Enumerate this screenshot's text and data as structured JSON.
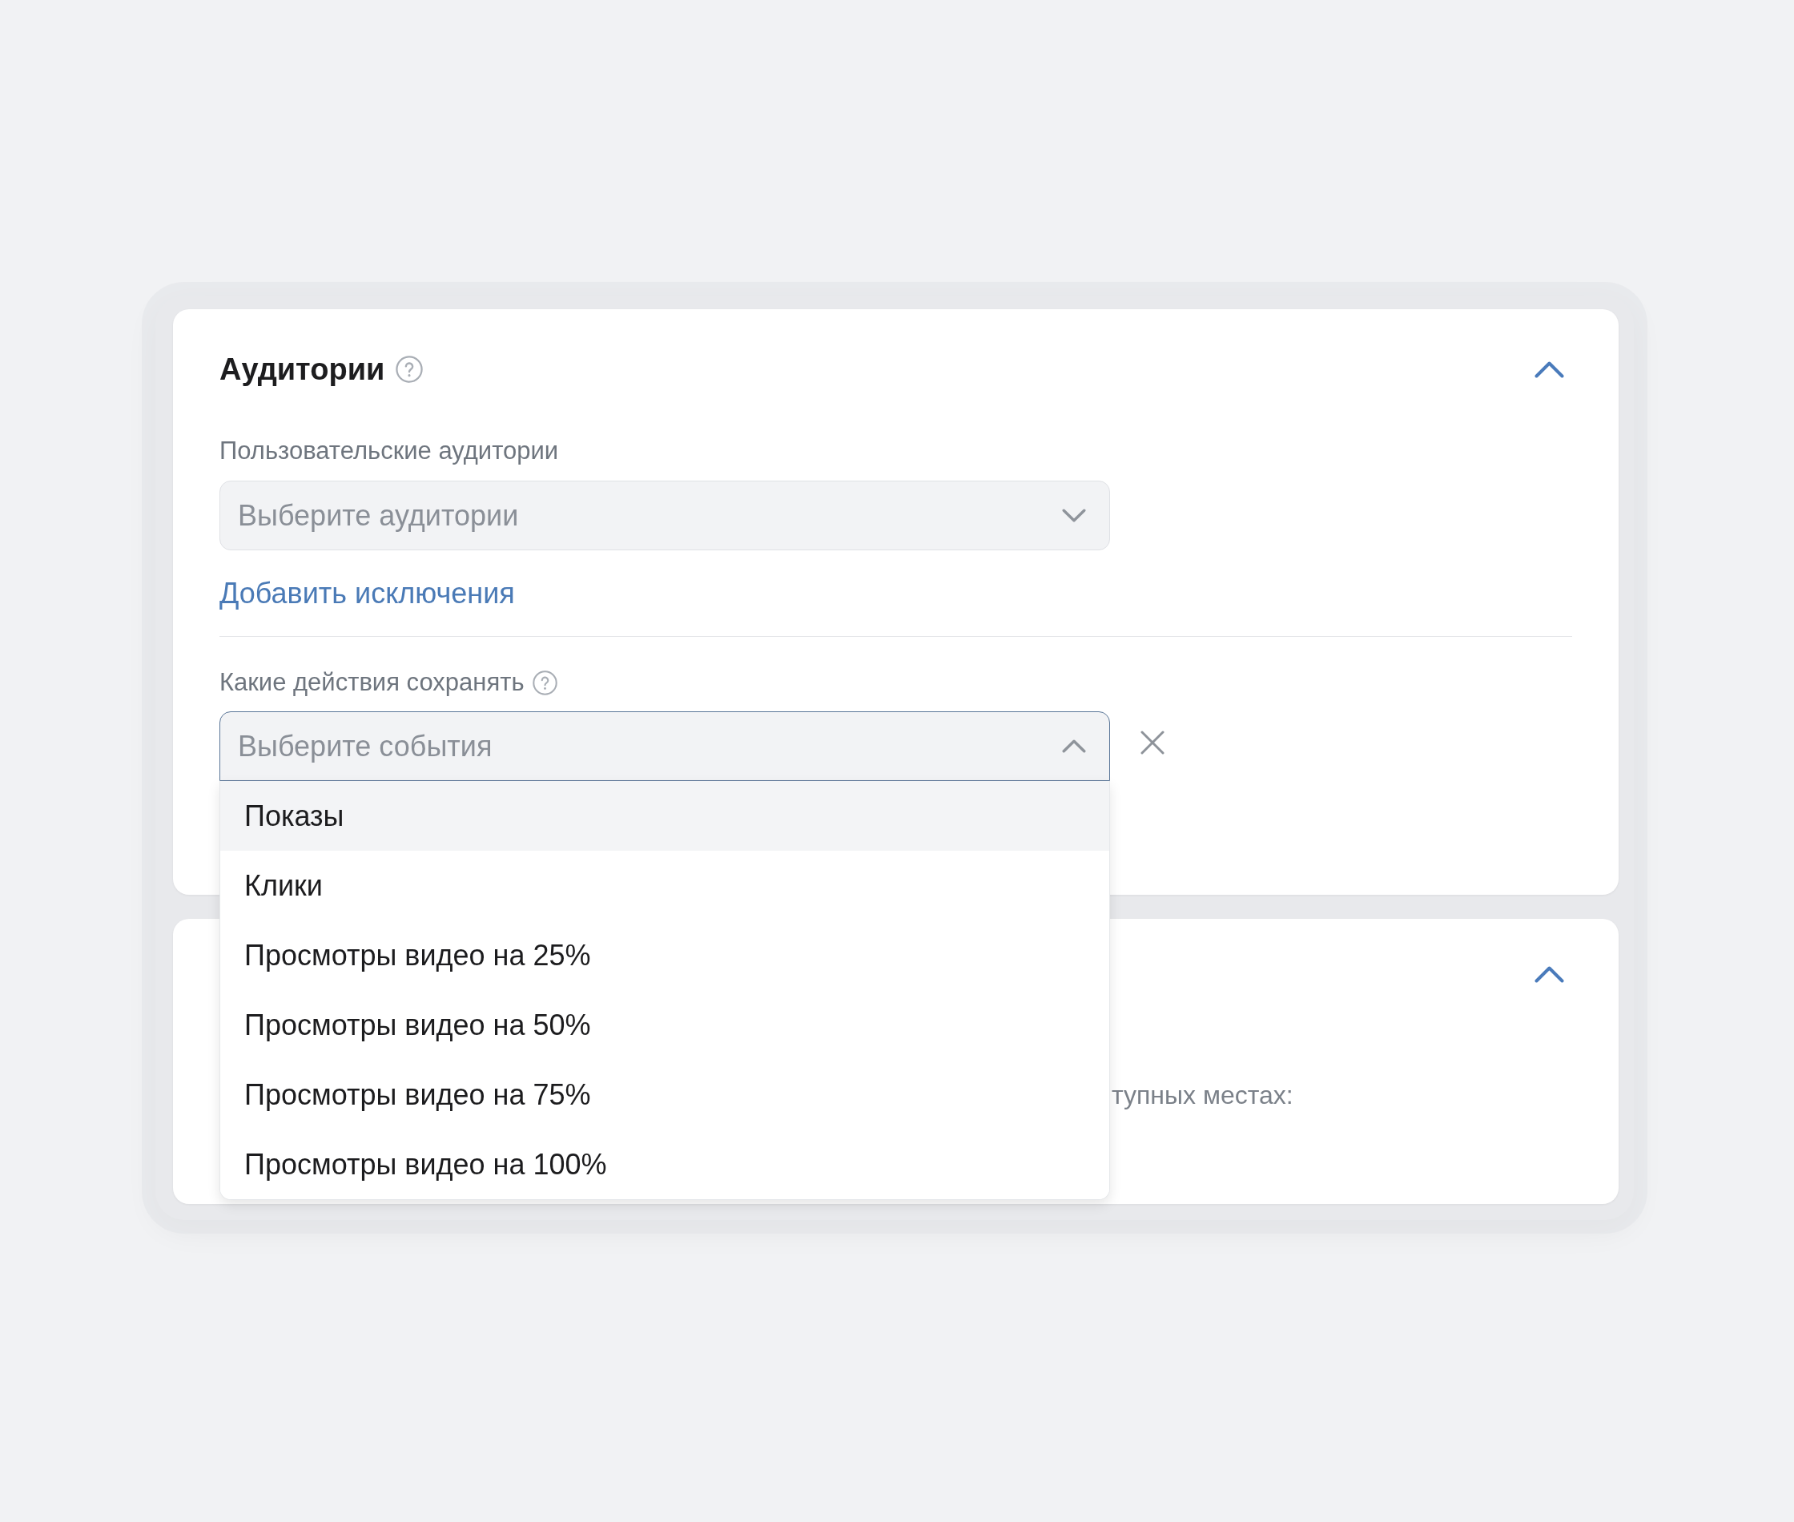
{
  "audiences_card": {
    "title": "Аудитории",
    "expanded": true,
    "custom_audiences": {
      "label": "Пользовательские аудитории",
      "placeholder": "Выберите аудитории",
      "expanded": false
    },
    "add_exclusions_link": "Добавить исключения",
    "saved_actions": {
      "label": "Какие действия сохранять",
      "placeholder": "Выберите события",
      "expanded": true,
      "options": [
        {
          "label": "Показы",
          "highlighted": true
        },
        {
          "label": "Клики",
          "highlighted": false
        },
        {
          "label": "Просмотры видео на 25%",
          "highlighted": false
        },
        {
          "label": "Просмотры видео на 50%",
          "highlighted": false
        },
        {
          "label": "Просмотры видео на 75%",
          "highlighted": false
        },
        {
          "label": "Просмотры видео на 100%",
          "highlighted": false
        }
      ]
    }
  },
  "second_card": {
    "expanded": true,
    "partial_text": "тупных местах:"
  }
}
